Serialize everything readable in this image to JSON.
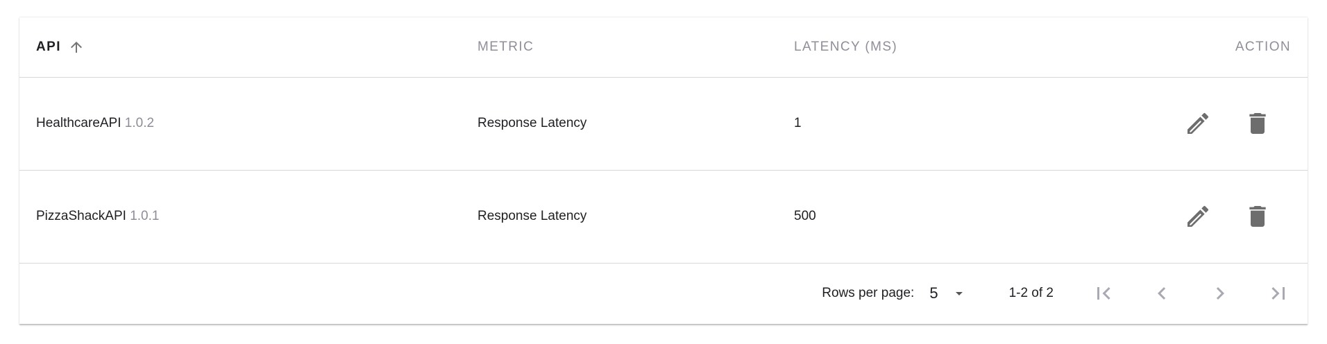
{
  "table": {
    "headers": {
      "api": "API",
      "metric": "METRIC",
      "latency": "LATENCY (MS)",
      "action": "ACTION"
    },
    "sort": {
      "column": "api",
      "direction": "ascending",
      "icon": "arrow-up-icon"
    },
    "rows": [
      {
        "api_name": "HealthcareAPI",
        "api_version": "1.0.2",
        "metric": "Response Latency",
        "latency": "1",
        "actions": [
          "edit-icon",
          "delete-icon"
        ]
      },
      {
        "api_name": "PizzaShackAPI",
        "api_version": "1.0.1",
        "metric": "Response Latency",
        "latency": "500",
        "actions": [
          "edit-icon",
          "delete-icon"
        ]
      }
    ]
  },
  "pagination": {
    "rows_per_page_label": "Rows per page:",
    "rows_per_page_value": "5",
    "range_label": "1-2 of 2",
    "buttons": [
      "first-page-icon",
      "previous-page-icon",
      "next-page-icon",
      "last-page-icon"
    ]
  },
  "colors": {
    "text_primary": "#1f1f23",
    "text_muted": "#8f8f99",
    "icon": "#6d6d6d",
    "pager_icon": "#a9a9b3",
    "divider": "#d7d7d7"
  }
}
